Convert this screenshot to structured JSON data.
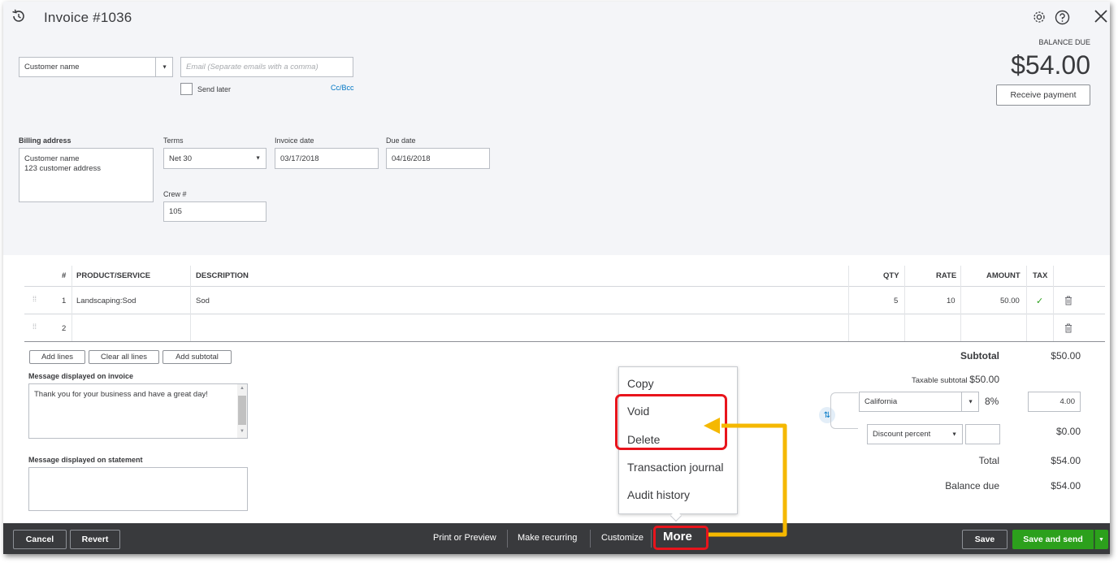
{
  "header": {
    "title": "Invoice #1036",
    "balance_due_label": "BALANCE DUE",
    "balance_due_amount": "$54.00",
    "receive_payment": "Receive payment"
  },
  "customer": {
    "name_placeholder": "Customer name",
    "email_placeholder": "Email (Separate emails with a comma)",
    "send_later": "Send later",
    "cc_bcc": "Cc/Bcc"
  },
  "billing": {
    "billing_address_label": "Billing address",
    "billing_line1": "Customer name",
    "billing_line2": "123 customer address",
    "terms_label": "Terms",
    "terms_value": "Net 30",
    "invoice_date_label": "Invoice date",
    "invoice_date_value": "03/17/2018",
    "due_date_label": "Due date",
    "due_date_value": "04/16/2018",
    "crew_label": "Crew #",
    "crew_value": "105"
  },
  "table": {
    "headers": {
      "num": "#",
      "product": "PRODUCT/SERVICE",
      "description": "DESCRIPTION",
      "qty": "QTY",
      "rate": "RATE",
      "amount": "AMOUNT",
      "tax": "TAX"
    },
    "rows": [
      {
        "num": "1",
        "product": "Landscaping:Sod",
        "description": "Sod",
        "qty": "5",
        "rate": "10",
        "amount": "50.00",
        "tax": "✓"
      },
      {
        "num": "2",
        "product": "",
        "description": "",
        "qty": "",
        "rate": "",
        "amount": "",
        "tax": ""
      }
    ],
    "add_lines": "Add lines",
    "clear_all_lines": "Clear all lines",
    "add_subtotal": "Add subtotal"
  },
  "messages": {
    "invoice_label": "Message displayed on invoice",
    "invoice_text": "Thank you for your business and have a great day!",
    "statement_label": "Message displayed on statement"
  },
  "totals": {
    "subtotal_label": "Subtotal",
    "subtotal_value": "$50.00",
    "taxable_label": "Taxable subtotal",
    "taxable_value": "$50.00",
    "tax_region": "California",
    "tax_rate": "8%",
    "tax_amount": "4.00",
    "discount_type": "Discount percent",
    "discount_value": "$0.00",
    "total_label": "Total",
    "total_value": "$54.00",
    "balance_due_label": "Balance due",
    "balance_due_value": "$54.00"
  },
  "more_menu": {
    "items": [
      "Copy",
      "Void",
      "Delete",
      "Transaction journal",
      "Audit history"
    ]
  },
  "footer": {
    "cancel": "Cancel",
    "revert": "Revert",
    "print_preview": "Print or Preview",
    "make_recurring": "Make recurring",
    "customize": "Customize",
    "more": "More",
    "save": "Save",
    "save_and_send": "Save and send"
  },
  "colors": {
    "green": "#2ca01c",
    "dark_footer": "#393a3d",
    "highlight_red": "#e8141c",
    "arrow_yellow": "#f5b800",
    "link_blue": "#0077c5"
  }
}
